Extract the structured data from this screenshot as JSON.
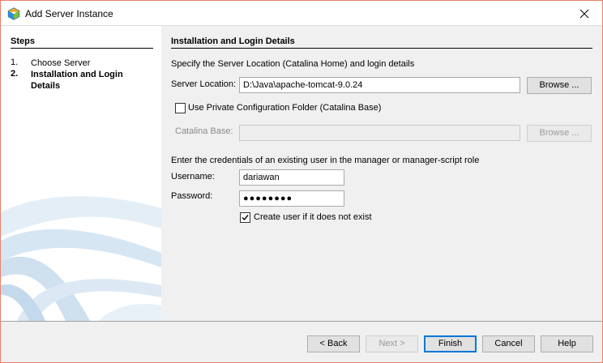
{
  "window": {
    "title": "Add Server Instance"
  },
  "steps": {
    "heading": "Steps",
    "items": [
      {
        "num": "1.",
        "label": "Choose Server"
      },
      {
        "num": "2.",
        "label": "Installation and Login Details"
      }
    ]
  },
  "content": {
    "heading": "Installation and Login Details",
    "intro": "Specify the Server Location (Catalina Home) and login details",
    "server_location_label": "Server Location:",
    "server_location_value": "D:\\Java\\apache-tomcat-9.0.24",
    "browse_label": "Browse ...",
    "private_config_label": "Use Private Configuration Folder (Catalina Base)",
    "private_config_checked": false,
    "catalina_base_label": "Catalina Base:",
    "catalina_base_value": "",
    "browse_disabled_label": "Browse ...",
    "credentials_text": "Enter the credentials of an existing user in the manager or manager-script role",
    "username_label": "Username:",
    "username_value": "dariawan",
    "password_label": "Password:",
    "password_value": "●●●●●●●●",
    "create_user_label": "Create user if it does not exist",
    "create_user_checked": true
  },
  "footer": {
    "back": "< Back",
    "next": "Next >",
    "finish": "Finish",
    "cancel": "Cancel",
    "help": "Help"
  },
  "colors": {
    "accent": "#0078d7",
    "window_border": "#e8806a"
  }
}
